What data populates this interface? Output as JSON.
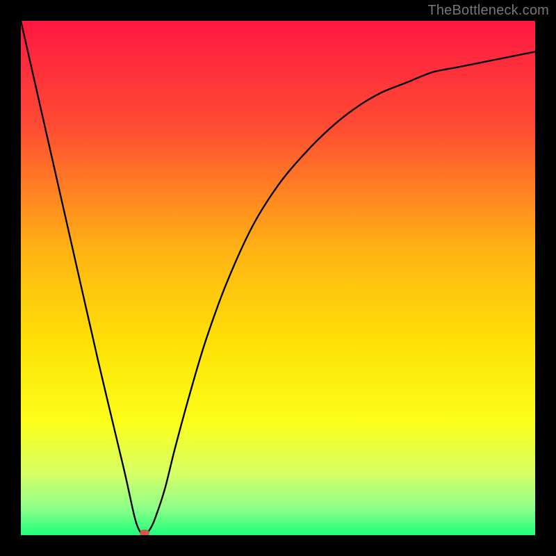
{
  "watermark": "TheBottleneck.com",
  "chart_data": {
    "type": "line",
    "title": "",
    "xlabel": "",
    "ylabel": "",
    "xlim": [
      0,
      100
    ],
    "ylim": [
      0,
      100
    ],
    "grid": false,
    "legend": false,
    "series": [
      {
        "name": "bottleneck-curve",
        "x": [
          0,
          5,
          10,
          15,
          20,
          22,
          23,
          24,
          25,
          26,
          28,
          30,
          33,
          36,
          40,
          45,
          50,
          55,
          60,
          65,
          70,
          75,
          80,
          85,
          90,
          95,
          100
        ],
        "values": [
          100,
          78,
          56,
          34,
          13,
          4,
          1,
          0,
          1,
          3,
          9,
          17,
          28,
          38,
          49,
          60,
          68,
          74,
          79,
          83,
          86,
          88,
          90,
          91,
          92,
          93,
          94
        ]
      }
    ],
    "marker": {
      "name": "optimal-point",
      "x": 24,
      "y": 0,
      "color": "#cc5a4a"
    },
    "background_gradient": [
      {
        "stop": 0.0,
        "color": "#ff1842"
      },
      {
        "stop": 0.2,
        "color": "#ff4a33"
      },
      {
        "stop": 0.45,
        "color": "#ffb514"
      },
      {
        "stop": 0.63,
        "color": "#ffe205"
      },
      {
        "stop": 0.78,
        "color": "#fbff1a"
      },
      {
        "stop": 0.88,
        "color": "#d6ff66"
      },
      {
        "stop": 0.95,
        "color": "#8aff8a"
      },
      {
        "stop": 1.0,
        "color": "#1eff7a"
      }
    ]
  }
}
